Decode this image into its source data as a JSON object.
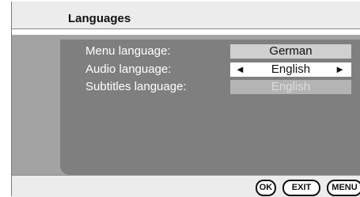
{
  "header": {
    "title": "Languages"
  },
  "settings": [
    {
      "label": "Menu language:",
      "value": "German",
      "state": "inactive"
    },
    {
      "label": "Audio language:",
      "value": "English",
      "state": "selected"
    },
    {
      "label": "Subtitles language:",
      "value": "English",
      "state": "disabled"
    }
  ],
  "arrows": {
    "left": "◄",
    "right": "►"
  },
  "footer": {
    "ok_label": "OK",
    "exit_label": "EXIT",
    "menu_label": "MENU"
  },
  "colors": {
    "title_bar": "#ececec",
    "content_band": "#a3a3a3",
    "menu_panel": "#7f7f7f",
    "selected_value": "#ffffff",
    "disabled_value": "#b4b4b4"
  }
}
